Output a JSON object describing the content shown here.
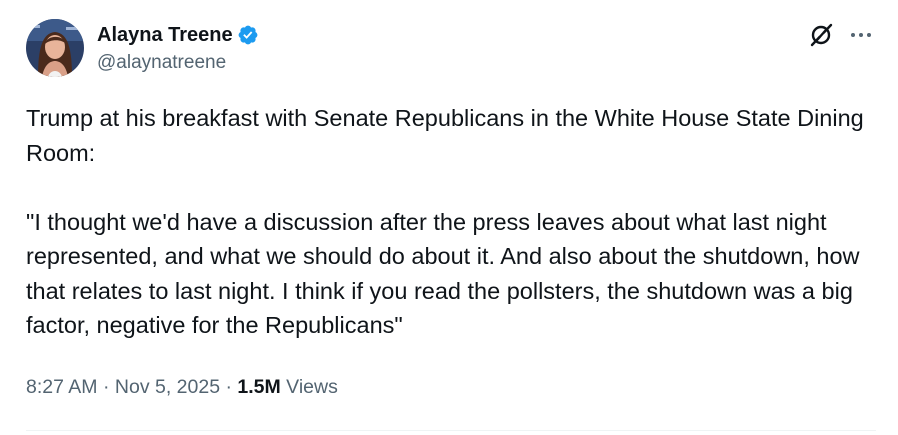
{
  "author": {
    "display_name": "Alayna Treene",
    "handle": "@alaynatreene",
    "verified": true
  },
  "tweet": {
    "text": "Trump at his breakfast with Senate Republicans in the White House State Dining Room:\n\n\"I thought we'd have a discussion after the press leaves about what last night represented, and what we should do about it. And also about the shutdown, how that relates to last night. I think if you read the pollsters, the shutdown was a big factor, negative for the Republicans\""
  },
  "meta": {
    "time": "8:27 AM",
    "separator": " · ",
    "date": "Nov 5, 2025",
    "view_count": "1.5M",
    "views_label": " Views"
  },
  "icons": {
    "verified": "verified-badge-icon",
    "grok": "grok-icon",
    "more": "more-options-icon"
  },
  "colors": {
    "verified_blue": "#1d9bf0",
    "primary_text": "#0f1419",
    "secondary_text": "#536471"
  }
}
